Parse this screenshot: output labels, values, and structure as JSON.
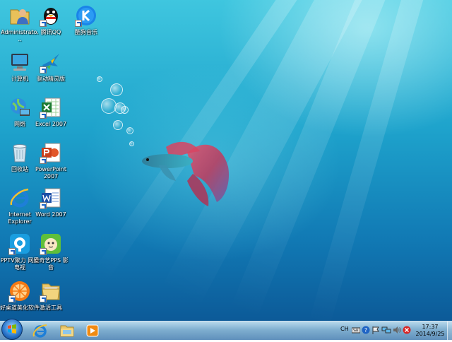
{
  "desktop": {
    "icons": [
      {
        "label": "Administrato...",
        "icon": "user-folder-icon"
      },
      {
        "label": "腾讯QQ",
        "icon": "qq-penguin-icon"
      },
      {
        "label": "酷狗音乐",
        "icon": "kugou-icon"
      },
      {
        "label": "计算机",
        "icon": "computer-icon"
      },
      {
        "label": "驱动精灵版",
        "icon": "bird-icon"
      },
      {
        "label": "网络",
        "icon": "network-icon"
      },
      {
        "label": "Excel 2007",
        "icon": "excel-icon"
      },
      {
        "label": "回收站",
        "icon": "recycle-bin-icon"
      },
      {
        "label": "PowerPoint 2007",
        "icon": "powerpoint-icon"
      },
      {
        "label": "Internet Explorer",
        "icon": "ie-icon"
      },
      {
        "label": "Word 2007",
        "icon": "word-icon"
      },
      {
        "label": "PPTV聚力 网络电视",
        "icon": "pptv-icon"
      },
      {
        "label": "爱奇艺PPS 影音",
        "icon": "pps-icon"
      },
      {
        "label": "好桌道美化软件",
        "icon": "orange-icon"
      },
      {
        "label": "激活工具",
        "icon": "folder-icon"
      }
    ]
  },
  "taskbar": {
    "start_icon": "windows-logo-icon",
    "pinned": [
      "ie-icon",
      "explorer-folder-icon",
      "media-player-icon"
    ],
    "tray": {
      "language": "CH",
      "icons": [
        "keyboard-icon",
        "help-icon",
        "flag-icon",
        "network-icon",
        "volume-icon",
        "security-icon"
      ]
    },
    "clock": {
      "time": "17:37",
      "date": "2014/9/25"
    }
  },
  "colors": {
    "desktop_top": "#3fc6df",
    "desktop_bottom": "#0c5a98",
    "taskbar": "#7fb0d3"
  }
}
